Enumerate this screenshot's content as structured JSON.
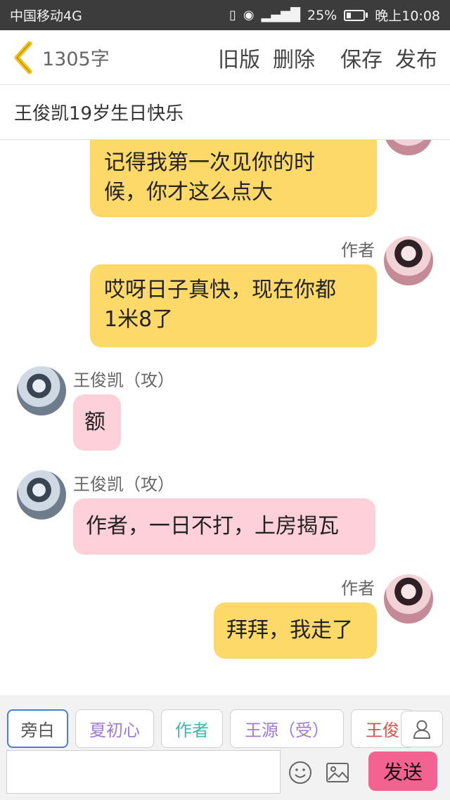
{
  "statusbar": {
    "carrier": "中国移动4G",
    "battery": "25%",
    "time": "晚上10:08",
    "battery_level": 0.25
  },
  "header": {
    "word_count": "1305字",
    "old_version": "旧版",
    "delete": "删除",
    "save": "保存",
    "publish": "发布"
  },
  "title": "王俊凯19岁生日快乐",
  "messages": [
    {
      "text_line1": "记得我第一次见你的时",
      "text_line2": "候，你才这么点大"
    },
    {
      "sender": "作者",
      "text_line1": "哎呀日子真快，现在你都",
      "text_line2": "1米8了"
    },
    {
      "sender": "王俊凯（攻）",
      "text": "额"
    },
    {
      "sender": "王俊凯（攻）",
      "text": "作者，一日不打，上房揭瓦"
    },
    {
      "sender": "作者",
      "text": "拜拜，我走了"
    }
  ],
  "roles": [
    {
      "label": "旁白",
      "color": "#555555"
    },
    {
      "label": "夏初心",
      "color": "#a07ad8"
    },
    {
      "label": "作者",
      "color": "#3db8b0"
    },
    {
      "label": "王源（受）",
      "color": "#a07ad8"
    },
    {
      "label": "王俊",
      "color": "#e0504a"
    }
  ],
  "input": {
    "placeholder": "",
    "send_label": "发送"
  },
  "icons": [
    "back-icon",
    "person-icon",
    "emoji-icon",
    "image-icon"
  ]
}
